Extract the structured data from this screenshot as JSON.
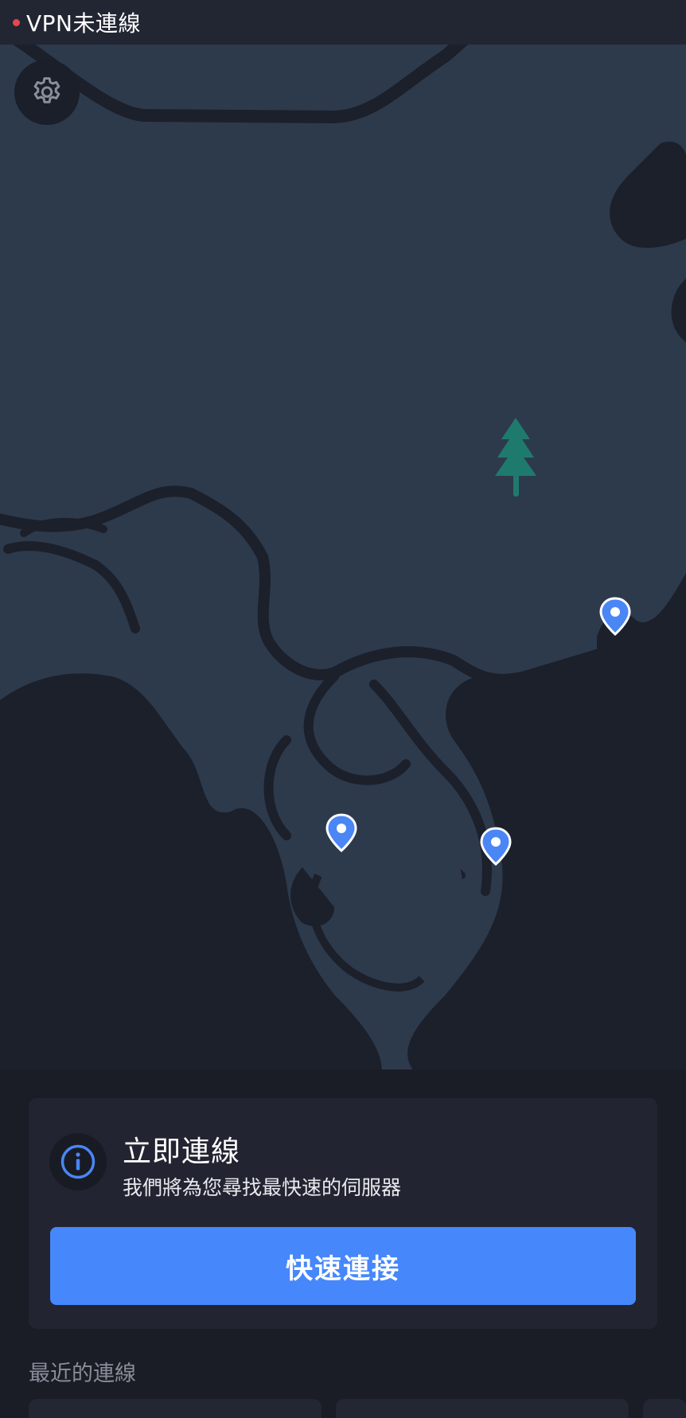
{
  "status_bar": {
    "vpn_status_text": "VPN未連線",
    "status_color": "#e5484d"
  },
  "map": {
    "settings_icon": "gear-icon",
    "server_pin_icon": "location-pin-icon",
    "tree_icon": "pine-tree-icon",
    "land_color": "#2d3a4c",
    "water_color": "#1b202b",
    "pin_color": "#4a86f4"
  },
  "connect_card": {
    "icon": "info-icon",
    "title": "立即連線",
    "subtitle": "我們將為您尋找最快速的伺服器",
    "quick_connect_label": "快速連接",
    "accent_color": "#4687fb"
  },
  "recent": {
    "label": "最近的連線"
  }
}
